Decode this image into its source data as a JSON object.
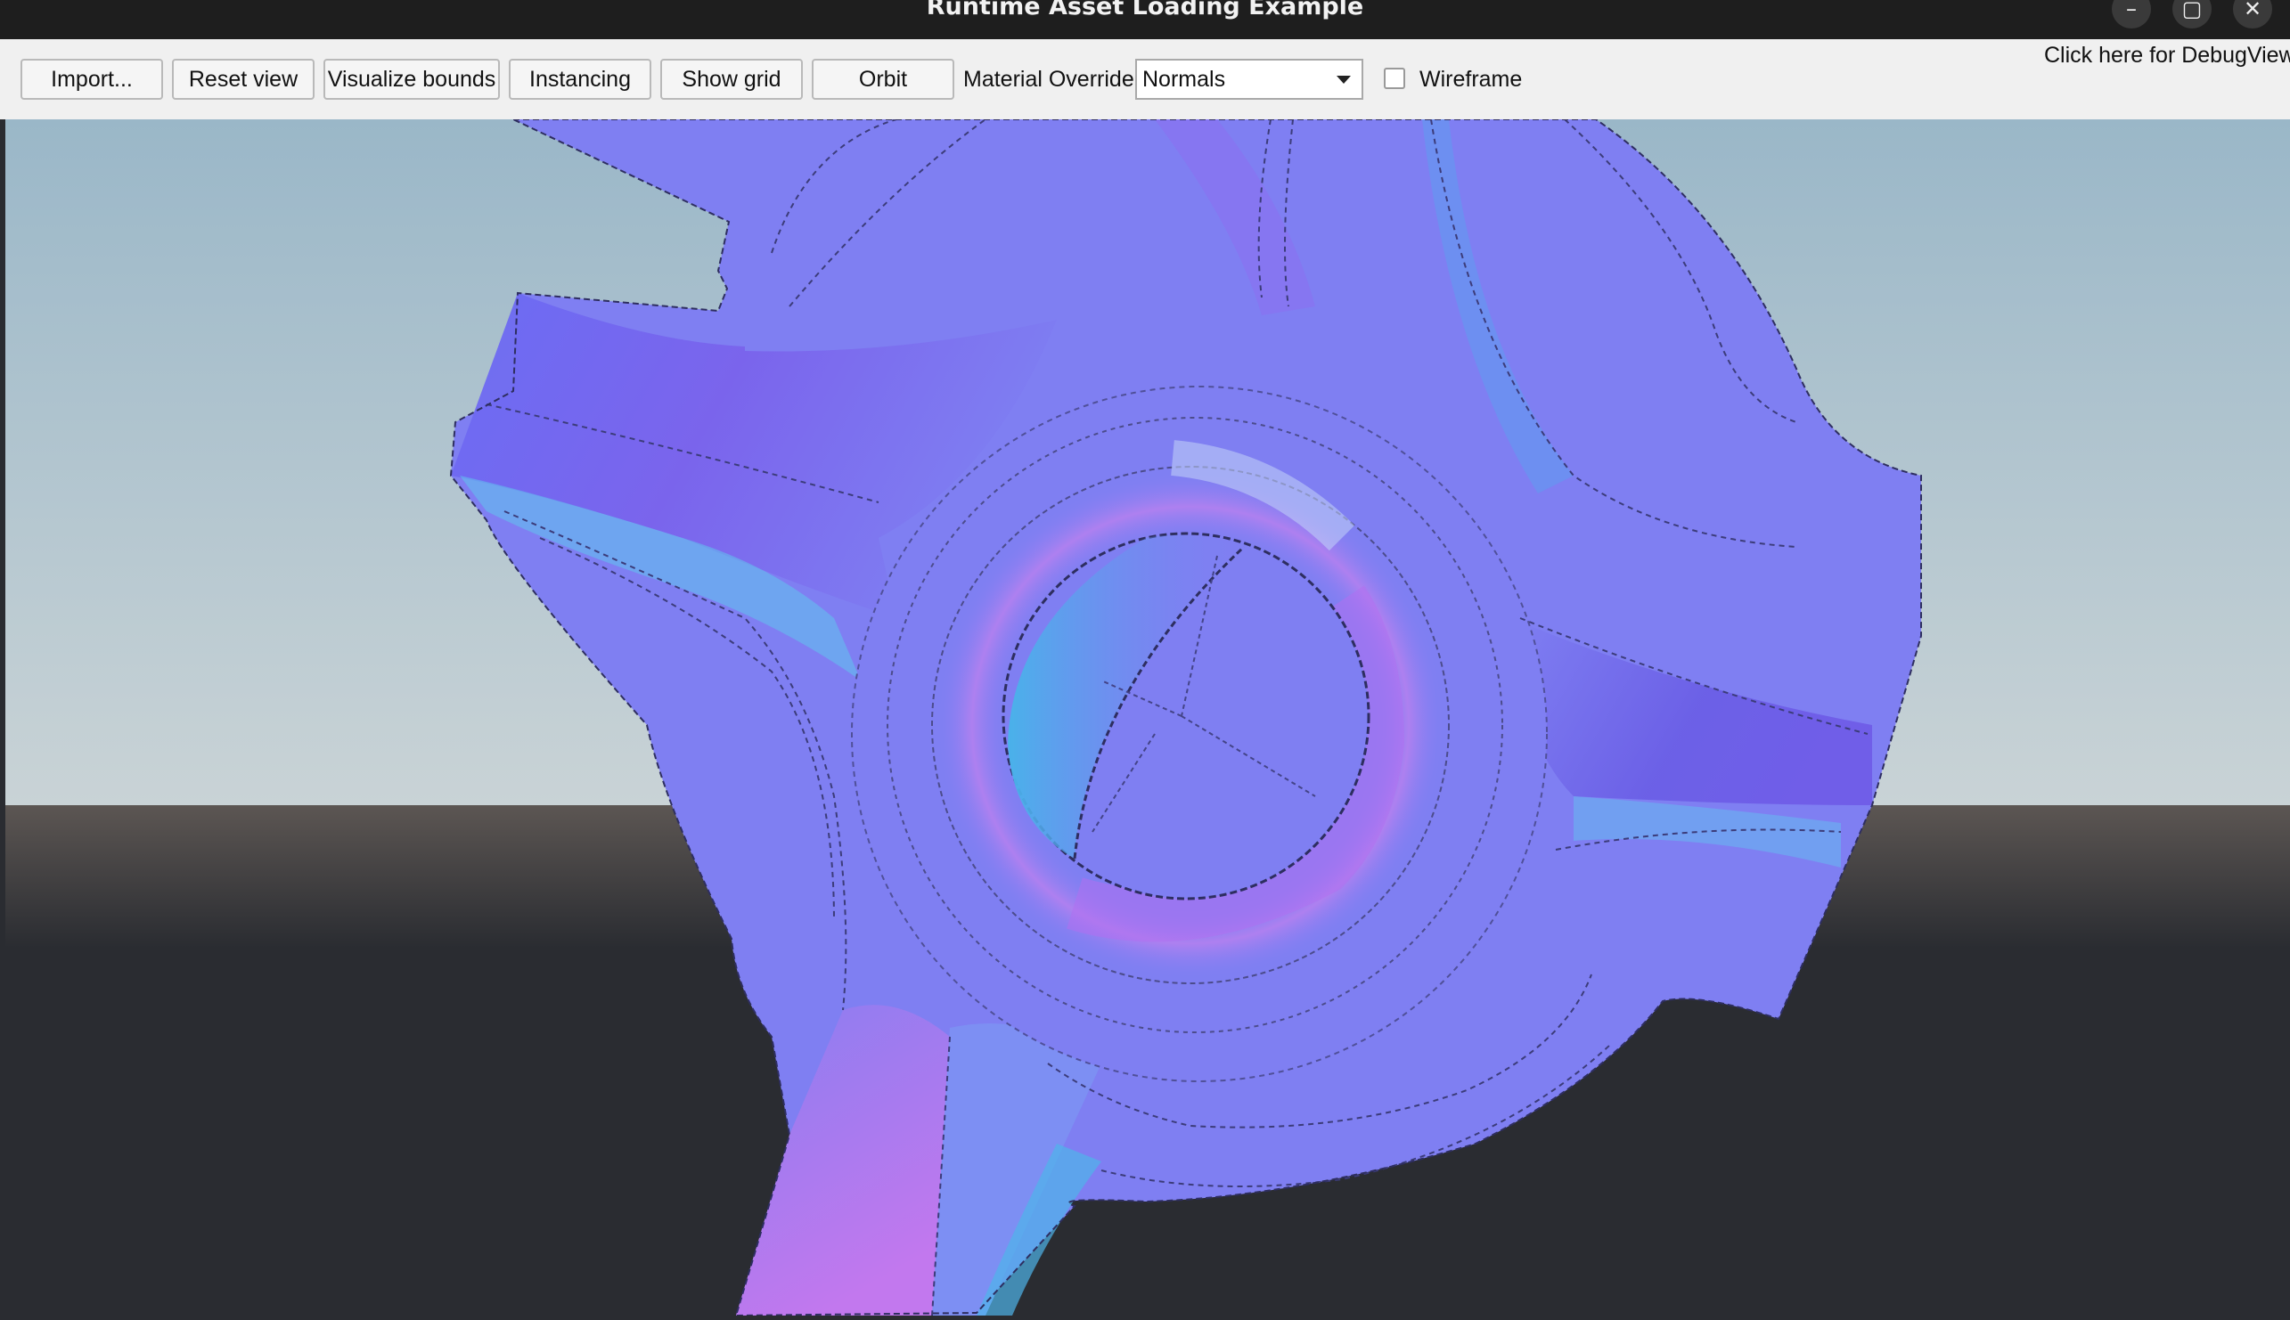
{
  "window": {
    "title": "Runtime Asset Loading Example",
    "minimize_glyph": "–",
    "maximize_glyph": "▢",
    "close_glyph": "✕"
  },
  "toolbar": {
    "import_label": "Import...",
    "reset_view_label": "Reset view",
    "visualize_bounds_label": "Visualize bounds",
    "instancing_label": "Instancing",
    "show_grid_label": "Show grid",
    "orbit_label": "Orbit",
    "material_override_label": "Material Override",
    "material_override_value": "Normals",
    "wireframe_label": "Wireframe",
    "wireframe_checked": false,
    "debug_view_label": "Click here for DebugView"
  },
  "viewport": {
    "sky_colors": [
      "#9ab7c8",
      "#c9d3d6"
    ],
    "ground_colors": [
      "#5c5653",
      "#2a2c31"
    ],
    "mesh_base_color": "#7f7ff2"
  }
}
